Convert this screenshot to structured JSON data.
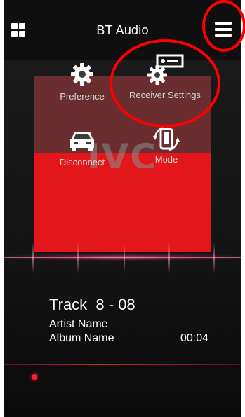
{
  "header": {
    "title": "BT Audio"
  },
  "menu": {
    "items": [
      {
        "label": "Preference",
        "icon": "gear-icon"
      },
      {
        "label": "Receiver Settings",
        "icon": "receiver-gear-icon"
      },
      {
        "label": "Disconnect",
        "icon": "car-icon"
      },
      {
        "label": "Mode",
        "icon": "phone-rotate-icon"
      }
    ]
  },
  "album_art": {
    "logo_text": "JVC"
  },
  "track": {
    "title": "Track  8 - 08",
    "artist": "Artist Name",
    "album": "Album Name",
    "elapsed": "00:04"
  },
  "colors": {
    "accent": "#e3161c",
    "annotation": "#ff0000",
    "background": "#000000"
  }
}
